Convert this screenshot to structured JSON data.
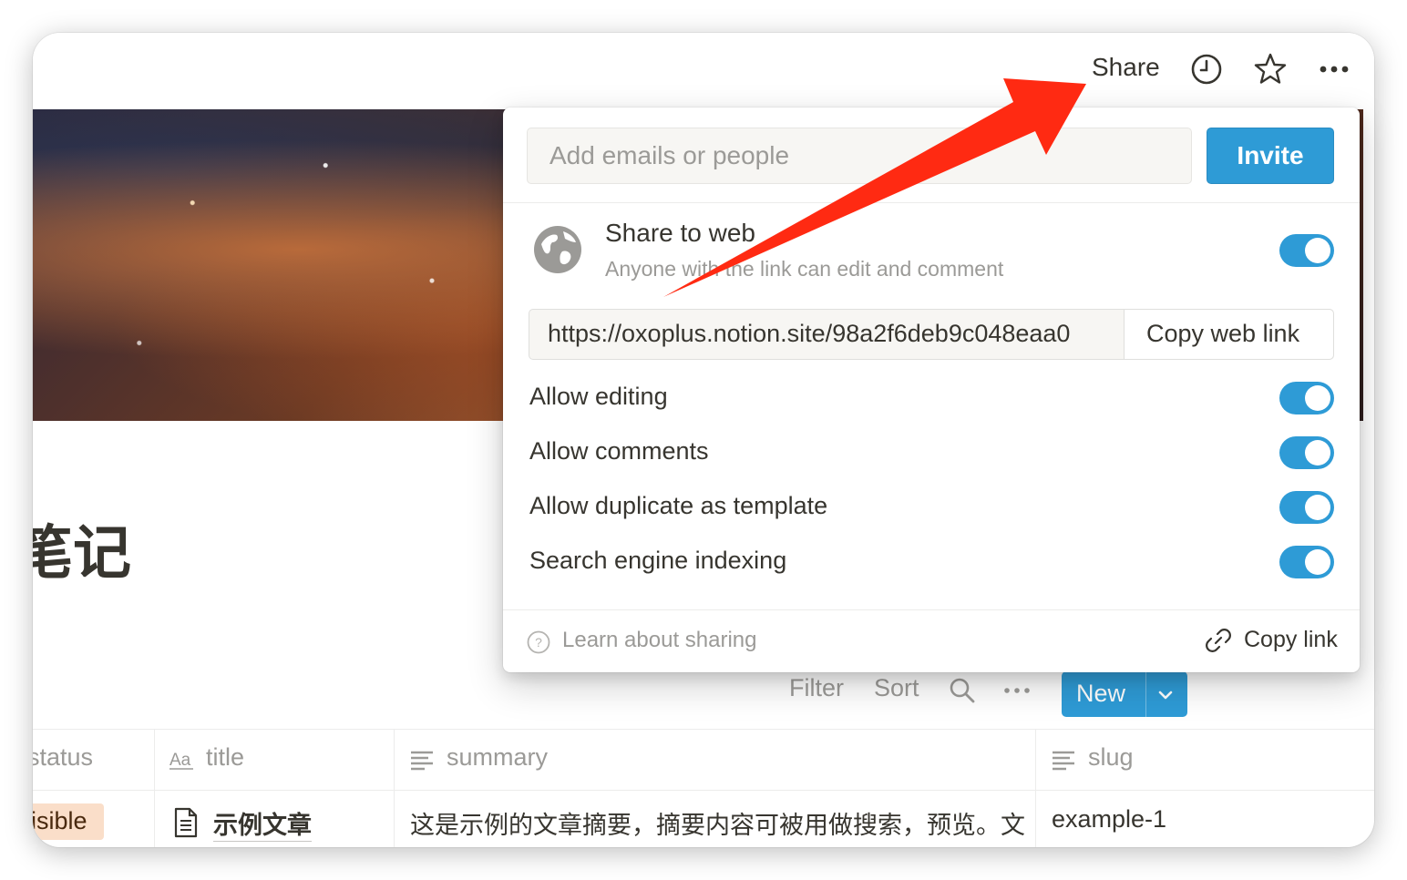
{
  "topbar": {
    "share_label": "Share",
    "icons": [
      "clock-icon",
      "star-icon",
      "more-icon"
    ]
  },
  "page": {
    "title_fragment": "笔记"
  },
  "database": {
    "toolbar": {
      "filter_label": "Filter",
      "sort_label": "Sort",
      "new_label": "New"
    },
    "columns": [
      {
        "name": "status",
        "icon": "select-icon"
      },
      {
        "name": "title",
        "icon": "text-aa-icon"
      },
      {
        "name": "summary",
        "icon": "text-lines-icon"
      },
      {
        "name": "slug",
        "icon": "text-lines-icon"
      }
    ],
    "rows": [
      {
        "status": "isible",
        "title": "示例文章",
        "summary": "这是示例的文章摘要，摘要内容可被用做搜索，预览。文",
        "slug": "example-1"
      }
    ]
  },
  "share_popup": {
    "email_placeholder": "Add emails or people",
    "invite_label": "Invite",
    "share_to_web": {
      "title": "Share to web",
      "subtitle": "Anyone with the link can edit and comment",
      "enabled": true
    },
    "web_link": "https://oxoplus.notion.site/98a2f6deb9c048eaa0",
    "copy_web_link_label": "Copy web link",
    "options": [
      {
        "label": "Allow editing",
        "enabled": true
      },
      {
        "label": "Allow comments",
        "enabled": true
      },
      {
        "label": "Allow duplicate as template",
        "enabled": true
      },
      {
        "label": "Search engine indexing",
        "enabled": true
      }
    ],
    "footer": {
      "learn_label": "Learn about sharing",
      "copy_link_label": "Copy link"
    }
  },
  "colors": {
    "accent": "#2e9bd6",
    "annotation_arrow": "#ff2a12",
    "status_pill": "#fadec9"
  }
}
